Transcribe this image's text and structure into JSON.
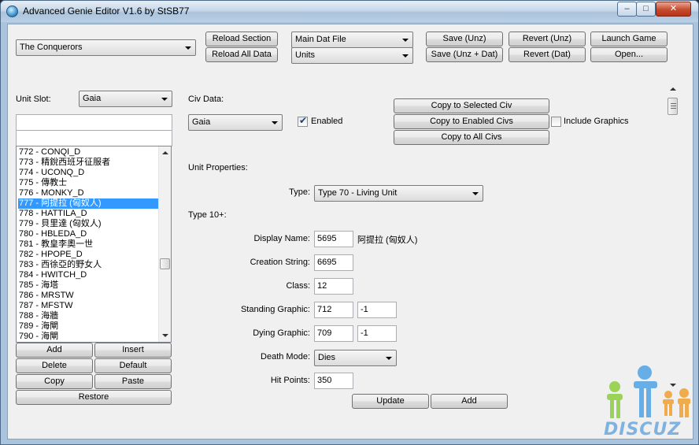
{
  "window": {
    "title": "Advanced Genie Editor V1.6 by StSB77",
    "min_glyph": "–",
    "max_glyph": "□",
    "close_glyph": "✕"
  },
  "toolbar": {
    "game_select": "The Conquerors",
    "reload_section": "Reload Section",
    "reload_all_data": "Reload All Data",
    "file_select": "Main Dat File",
    "section_select": "Units",
    "save_unz": "Save (Unz)",
    "save_unz_dat": "Save (Unz + Dat)",
    "revert_unz": "Revert (Unz)",
    "revert_dat": "Revert (Dat)",
    "launch_game": "Launch Game",
    "open": "Open..."
  },
  "left": {
    "unit_slot_label": "Unit Slot:",
    "unit_slot_value": "Gaia",
    "search_value": "",
    "exclude_value": "",
    "units": [
      "772 - CONQI_D",
      "773 - 精銳西班牙征服者",
      "774 - UCONQ_D",
      "775 - 傳教士",
      "776 - MONKY_D",
      "777 - 阿提拉 (匈奴人)",
      "778 - HATTILA_D",
      "779 - 貝里達 (匈奴人)",
      "780 - HBLEDA_D",
      "781 - 教皇李奧一世",
      "782 - HPOPE_D",
      "783 - 西徐亞的野女人",
      "784 - HWITCH_D",
      "785 - 海塔",
      "786 - MRSTW",
      "787 - MFSTW",
      "788 - 海牆",
      "789 - 海閘",
      "790 - 海閘"
    ],
    "selected_index": 5,
    "add": "Add",
    "insert": "Insert",
    "delete": "Delete",
    "default": "Default",
    "copy": "Copy",
    "paste": "Paste",
    "restore": "Restore"
  },
  "civ": {
    "label": "Civ Data:",
    "value": "Gaia",
    "enabled_label": "Enabled",
    "enabled": true,
    "copy_selected": "Copy to Selected Civ",
    "copy_enabled": "Copy to Enabled Civs",
    "copy_all": "Copy to All Civs",
    "include_graphics_label": "Include Graphics",
    "include_graphics": false
  },
  "unit_props": {
    "header": "Unit Properties:",
    "type_label": "Type:",
    "type_value": "Type 70 - Living Unit",
    "type10_header": "Type 10+:",
    "display_name_label": "Display Name:",
    "display_name_id": "5695",
    "display_name_text": "阿提拉 (匈奴人)",
    "creation_string_label": "Creation String:",
    "creation_string_id": "6695",
    "class_label": "Class:",
    "class_value": "12",
    "standing_graphic_label": "Standing Graphic:",
    "standing_graphic_1": "712",
    "standing_graphic_2": "-1",
    "dying_graphic_label": "Dying Graphic:",
    "dying_graphic_1": "709",
    "dying_graphic_2": "-1",
    "death_mode_label": "Death Mode:",
    "death_mode_value": "Dies",
    "hit_points_label": "Hit Points:",
    "hit_points_value": "350",
    "update": "Update",
    "add": "Add"
  },
  "watermark": {
    "text": "DISCUZ"
  },
  "colors": {
    "selection": "#3399ff",
    "window_frame": "#a9c4dc",
    "client_bg": "#f0f0f0"
  }
}
